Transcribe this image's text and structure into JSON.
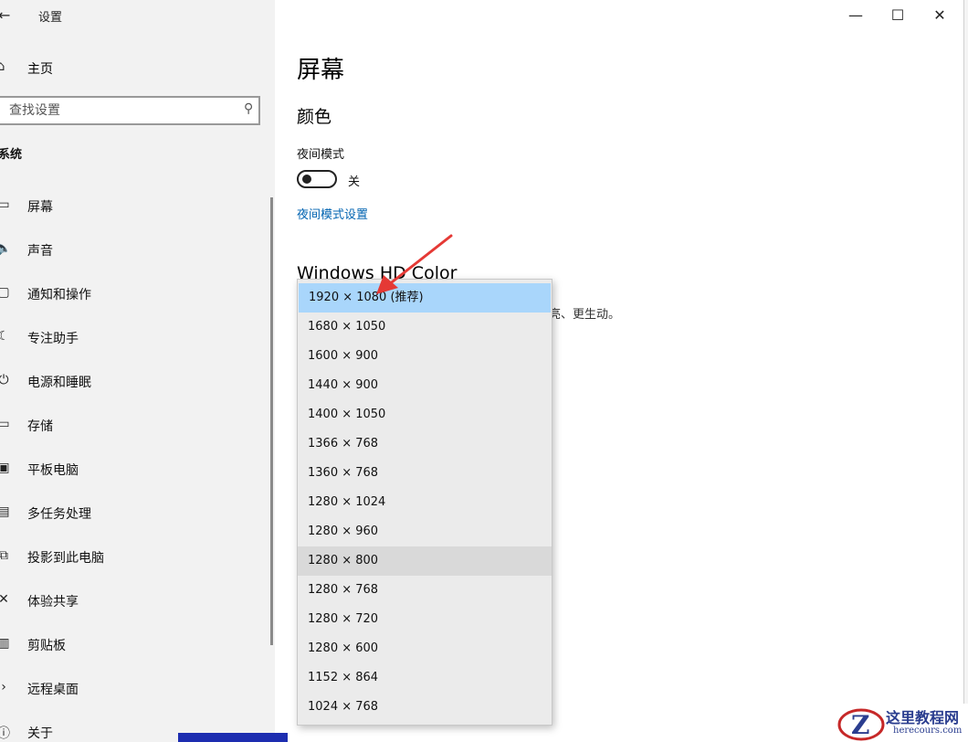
{
  "window": {
    "back_icon": "arrow-left-icon",
    "title": "设置",
    "controls": {
      "minimize": "—",
      "maximize": "☐",
      "close": "✕"
    }
  },
  "sidebar": {
    "home_label": "主页",
    "search_placeholder": "查找设置",
    "section": "系统",
    "items": [
      {
        "label": "屏幕",
        "icon": "monitor-icon"
      },
      {
        "label": "声音",
        "icon": "speaker-icon"
      },
      {
        "label": "通知和操作",
        "icon": "notification-icon"
      },
      {
        "label": "专注助手",
        "icon": "moon-icon"
      },
      {
        "label": "电源和睡眠",
        "icon": "power-icon"
      },
      {
        "label": "存储",
        "icon": "storage-icon"
      },
      {
        "label": "平板电脑",
        "icon": "tablet-icon"
      },
      {
        "label": "多任务处理",
        "icon": "multitask-icon"
      },
      {
        "label": "投影到此电脑",
        "icon": "project-icon"
      },
      {
        "label": "体验共享",
        "icon": "share-icon"
      },
      {
        "label": "剪贴板",
        "icon": "clipboard-icon"
      },
      {
        "label": "远程桌面",
        "icon": "remote-desktop-icon"
      },
      {
        "label": "关于",
        "icon": "info-icon"
      }
    ]
  },
  "main": {
    "page_title": "屏幕",
    "color_heading": "颜色",
    "night_mode_label": "夜间模式",
    "night_mode_state": "关",
    "night_mode_on": false,
    "night_mode_link": "夜间模式设置",
    "hd_heading": "Windows HD Color",
    "hd_desc_visible": "亮、更生动。"
  },
  "resolution_dropdown": {
    "selected": "1920 × 1080 (推荐)",
    "options": [
      "1920 × 1080 (推荐)",
      "1680 × 1050",
      "1600 × 900",
      "1440 × 900",
      "1400 × 1050",
      "1366 × 768",
      "1360 × 768",
      "1280 × 1024",
      "1280 × 960",
      "1280 × 800",
      "1280 × 768",
      "1280 × 720",
      "1280 × 600",
      "1152 × 864",
      "1024 × 768"
    ]
  },
  "watermark": {
    "title": "这里教程网",
    "url": "herecours.com"
  },
  "colors": {
    "sidebar_bg": "#f2f2f2",
    "link": "#0063b1",
    "selected_option": "#a9d6fb",
    "arrow": "#e53935"
  }
}
